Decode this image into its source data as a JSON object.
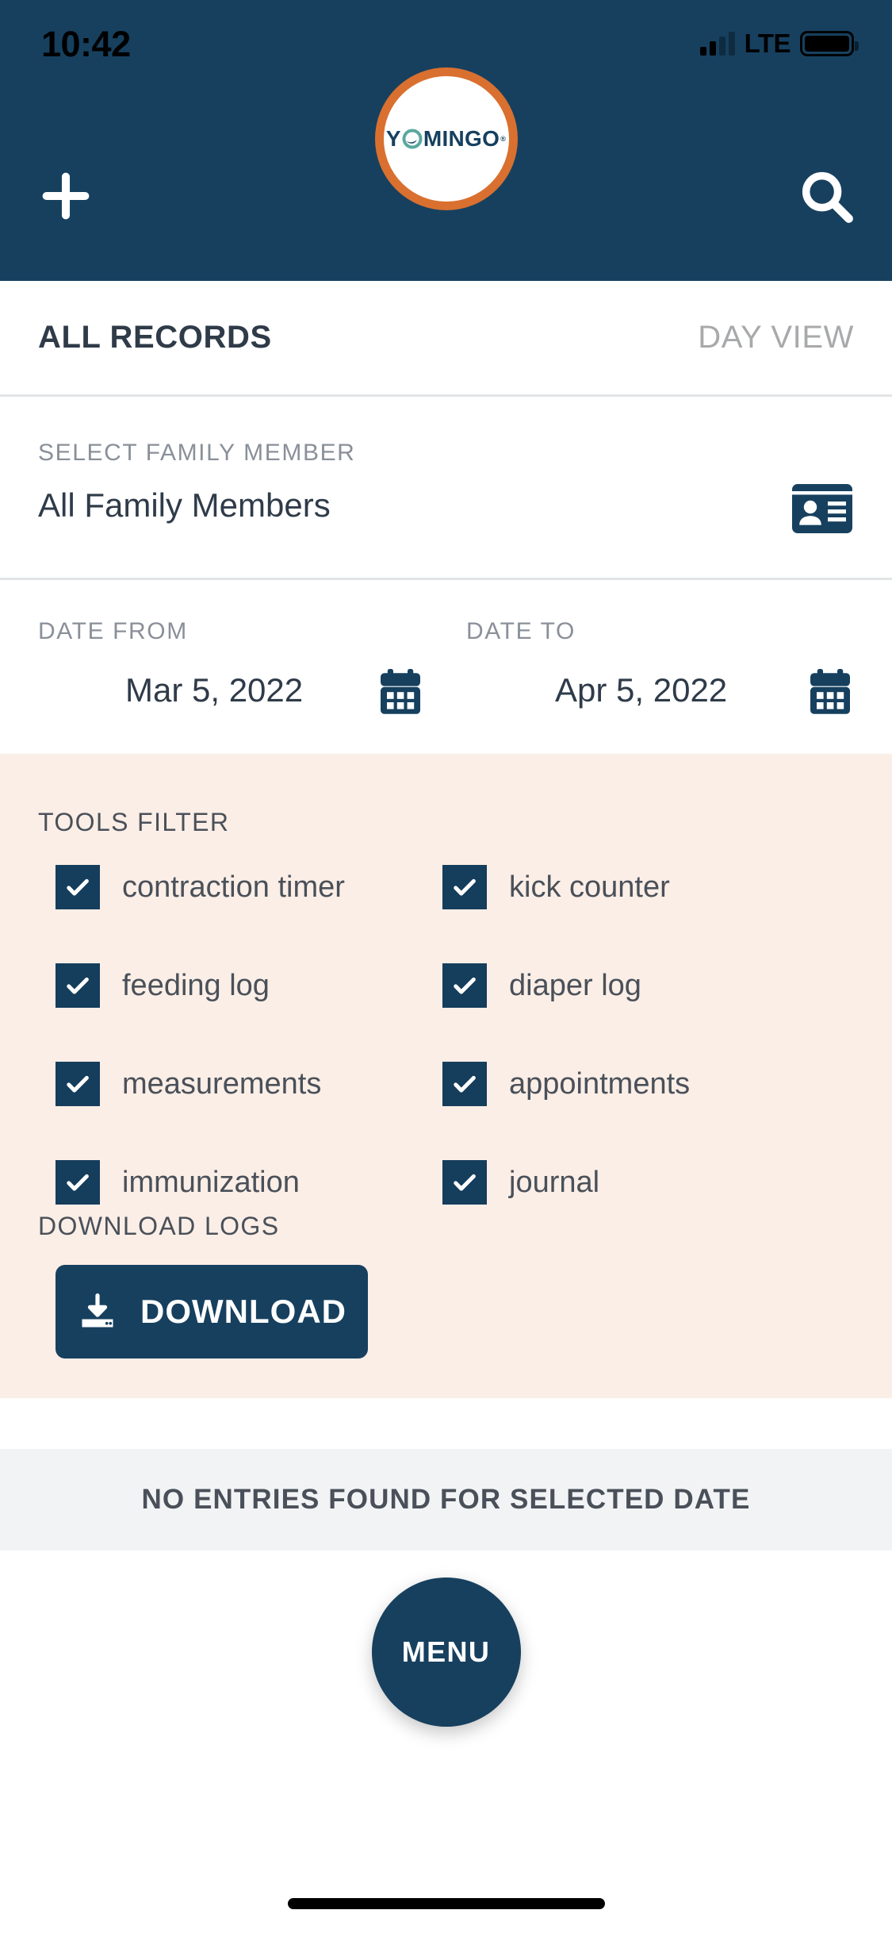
{
  "status_bar": {
    "time": "10:42",
    "network": "LTE",
    "signal_icon": "signal-bars-icon",
    "battery_icon": "battery-full-icon"
  },
  "header": {
    "background_color": "#17405f",
    "add_icon": "plus-icon",
    "search_icon": "search-icon",
    "logo": {
      "name": "yomingo-logo",
      "text_part_1": "Y",
      "text_part_2": "MINGO",
      "trademark": "®",
      "ring_color": "#d9702f",
      "text_color": "#17405f",
      "accent_color": "#5aa8a0"
    }
  },
  "tabs": [
    {
      "label": "ALL RECORDS",
      "active": true
    },
    {
      "label": "DAY VIEW",
      "active": false
    }
  ],
  "family_select": {
    "label": "SELECT FAMILY MEMBER",
    "value": "All Family Members",
    "icon": "id-card-icon"
  },
  "date_range": {
    "from_label": "DATE FROM",
    "from_value": "Mar 5, 2022",
    "to_label": "DATE TO",
    "to_value": "Apr 5, 2022",
    "calendar_icon": "calendar-icon"
  },
  "tools_filter": {
    "title": "TOOLS FILTER",
    "panel_color": "#faeee6",
    "checkbox_color": "#153d5c",
    "items": [
      {
        "label": "contraction timer",
        "checked": true
      },
      {
        "label": "kick counter",
        "checked": true
      },
      {
        "label": "feeding log",
        "checked": true
      },
      {
        "label": "diaper log",
        "checked": true
      },
      {
        "label": "measurements",
        "checked": true
      },
      {
        "label": "appointments",
        "checked": true
      },
      {
        "label": "immunization",
        "checked": true
      },
      {
        "label": "journal",
        "checked": true
      }
    ]
  },
  "download": {
    "title": "DOWNLOAD LOGS",
    "button_label": "DOWNLOAD",
    "icon": "download-icon",
    "button_color": "#17405f"
  },
  "empty_state": {
    "message": "NO ENTRIES FOUND FOR SELECTED DATE"
  },
  "menu_button": {
    "label": "MENU",
    "color": "#17405f"
  }
}
